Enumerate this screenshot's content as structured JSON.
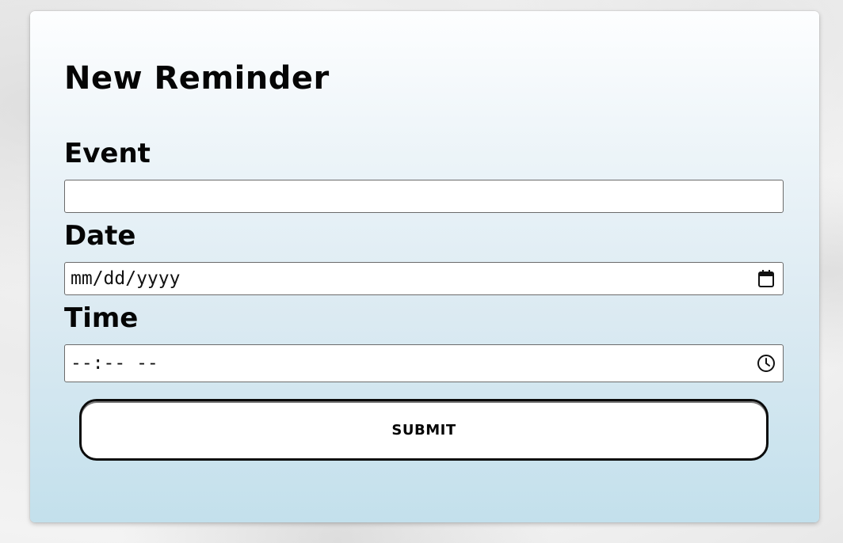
{
  "form": {
    "title": "New Reminder",
    "event": {
      "label": "Event",
      "value": "",
      "placeholder": ""
    },
    "date": {
      "label": "Date",
      "placeholder": "mm/dd/yyyy",
      "icon": "calendar-icon"
    },
    "time": {
      "label": "Time",
      "placeholder": "--:-- --",
      "icon": "clock-icon"
    },
    "submit_label": "SUBMIT"
  },
  "colors": {
    "card_gradient_top": "#fdfeff",
    "card_gradient_bottom": "#c3e0ec",
    "text": "#050505",
    "field_border": "#6b6b6b",
    "button_border": "#0b0b0b"
  }
}
